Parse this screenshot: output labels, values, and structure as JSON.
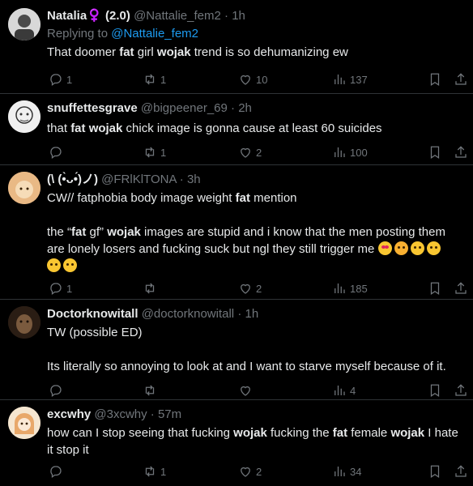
{
  "tweets": [
    {
      "name": "Natalia♀️ (2.0)",
      "handle": "@Nattalie_fem2",
      "time": "1h",
      "replying_prefix": "Replying to ",
      "replying_to": "@Nattalie_fem2",
      "text_parts": [
        "That doomer ",
        "fat",
        " girl ",
        "wojak",
        " trend is so dehumanizing ew"
      ],
      "replies": "1",
      "reposts": "1",
      "likes": "10",
      "views": "137",
      "avatar_colors": [
        "#cfcfcf",
        "#555555"
      ]
    },
    {
      "name": "snuffettesgrave",
      "handle": "@bigpeener_69",
      "time": "2h",
      "text_parts": [
        "that ",
        "fat wojak",
        " chick image is gonna cause at least 60 suicides"
      ],
      "replies": "",
      "reposts": "1",
      "likes": "2",
      "views": "100",
      "avatar_colors": [
        "#f2f2f2",
        "#333333"
      ]
    },
    {
      "name": "(\\ (•̀ᴗ•́)ノ)",
      "handle": "@FRlKlTONA",
      "time": "3h",
      "text_line1": "CW// fatphobia body image weight ",
      "text_line1_bold": "fat",
      "text_line1_end": " mention",
      "text_p2": [
        "the “",
        "fat",
        " gf” ",
        "wojak",
        " images are stupid and i know that the men posting them are lonely losers and fucking suck but ngl they still trigger me "
      ],
      "replies": "1",
      "reposts": "",
      "likes": "2",
      "views": "185",
      "avatar_colors": [
        "#e8b07a",
        "#f4d6b0"
      ]
    },
    {
      "name": "Doctorknowitall",
      "handle": "@doctorknowitall",
      "time": "1h",
      "text_line1": "TW (possible ED)",
      "text_p2": "Its literally so annoying to look at and I want to starve myself because of it.",
      "replies": "",
      "reposts": "",
      "likes": "",
      "views": "4",
      "avatar_colors": [
        "#3a2a1e",
        "#8a6a4a"
      ]
    },
    {
      "name": "excwhy",
      "handle": "@3xcwhy",
      "time": "57m",
      "text_parts": [
        "how can I stop seeing that fucking ",
        "wojak",
        " fucking the ",
        "fat",
        " female ",
        "wojak",
        " I hate it stop it"
      ],
      "replies": "",
      "reposts": "1",
      "likes": "2",
      "views": "34",
      "avatar_colors": [
        "#f6e2c8",
        "#e8a86a"
      ]
    }
  ],
  "icons": {
    "reply": "reply-icon",
    "repost": "repost-icon",
    "like": "heart-icon",
    "views": "views-icon",
    "bookmark": "bookmark-icon",
    "share": "share-icon"
  },
  "colors": {
    "background": "#000000",
    "text": "#e7e9ea",
    "muted": "#71767b",
    "link": "#1d9bf0",
    "divider": "#2f3336"
  }
}
